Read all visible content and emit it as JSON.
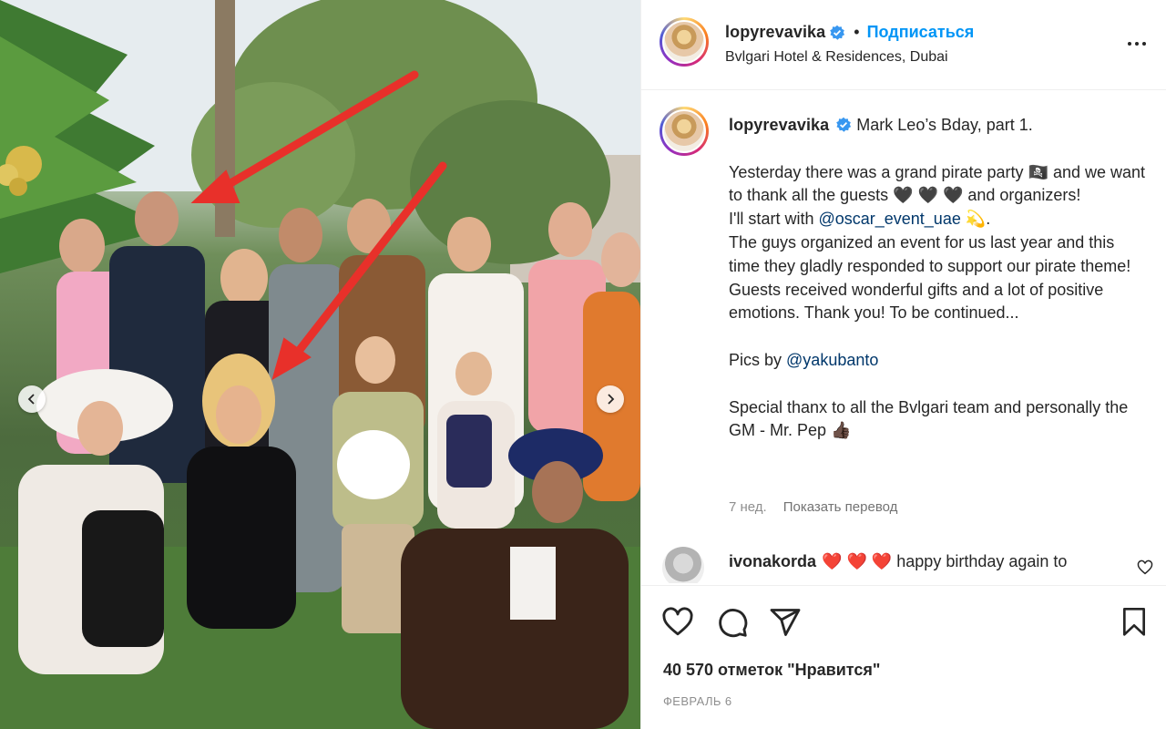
{
  "post": {
    "author": {
      "username": "lopyrevavika",
      "verified": true,
      "follow_label": "Подписаться",
      "separator": "•",
      "location": "Bvlgari Hotel & Residences, Dubai"
    },
    "caption": {
      "username": "lopyrevavika",
      "title": "Mark Leo’s Bday, part 1.",
      "para1_a": "Yesterday there was a grand pirate party 🏴‍☠️ and we want to thank all the guests 🖤 🖤 🖤 and organizers!",
      "para1_b_prefix": "I'll start with ",
      "para1_b_mention": "@oscar_event_uae",
      "para1_b_suffix": " 💫.",
      "para1_c": "The guys organized an event for us last year and this time they gladly responded to support our pirate theme! Guests received wonderful gifts and a lot of positive emotions. Thank you! To be continued...",
      "pics_prefix": "Pics by ",
      "pics_mention": "@yakubanto",
      "thanks": "Special thanx to all the Bvlgari team and personally the GM - Mr. Pep 👍🏿"
    },
    "meta": {
      "age": "7 нед.",
      "translate_label": "Показать перевод"
    },
    "comment": {
      "username": "ivonakorda",
      "text": "❤️ ❤️ ❤️ happy birthday again to"
    },
    "likes_label": "40 570 отметок \"Нравится\"",
    "date": "ФЕВРАЛЬ 6"
  },
  "icons": {
    "like": "heart-icon",
    "comment": "comment-icon",
    "share": "send-icon",
    "save": "bookmark-icon",
    "more": "more-dots-icon",
    "verified": "verified-badge-icon",
    "prev": "chevron-left-icon",
    "next": "chevron-right-icon"
  },
  "colors": {
    "accent": "#0095f6",
    "mention": "#00376b",
    "verified": "#3897f0",
    "muted": "#8e8e8e",
    "annotation_arrow": "#e8302a"
  }
}
